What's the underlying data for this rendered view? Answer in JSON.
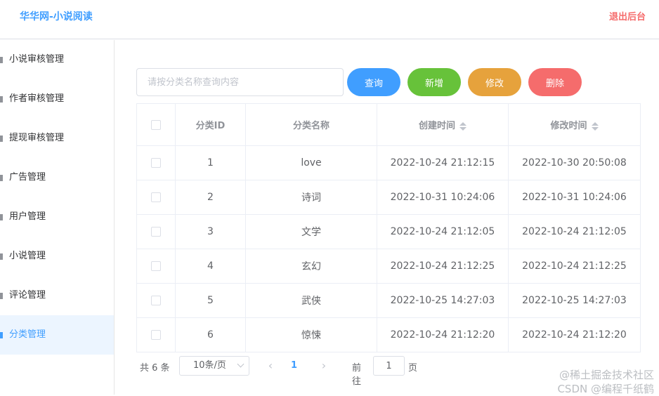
{
  "header": {
    "title": "华华网-小说阅读",
    "logout": "退出后台"
  },
  "sidebar": {
    "items": [
      {
        "label": "小说审核管理",
        "active": false
      },
      {
        "label": "作者审核管理",
        "active": false
      },
      {
        "label": "提现审核管理",
        "active": false
      },
      {
        "label": "广告管理",
        "active": false
      },
      {
        "label": "用户管理",
        "active": false
      },
      {
        "label": "小说管理",
        "active": false
      },
      {
        "label": "评论管理",
        "active": false
      },
      {
        "label": "分类管理",
        "active": true
      }
    ]
  },
  "search": {
    "placeholder": "请按分类名称查询内容",
    "value": ""
  },
  "buttons": {
    "query": "查询",
    "add": "新增",
    "edit": "修改",
    "delete": "删除"
  },
  "table": {
    "headers": {
      "id": "分类ID",
      "name": "分类名称",
      "created": "创建时间",
      "modified": "修改时间"
    },
    "rows": [
      {
        "id": "1",
        "name": "love",
        "created": "2022-10-24 21:12:15",
        "modified": "2022-10-30 20:50:08"
      },
      {
        "id": "2",
        "name": "诗词",
        "created": "2022-10-31 10:24:06",
        "modified": "2022-10-31 10:24:06"
      },
      {
        "id": "3",
        "name": "文学",
        "created": "2022-10-24 21:12:05",
        "modified": "2022-10-24 21:12:05"
      },
      {
        "id": "4",
        "name": "玄幻",
        "created": "2022-10-24 21:12:25",
        "modified": "2022-10-24 21:12:25"
      },
      {
        "id": "5",
        "name": "武侠",
        "created": "2022-10-25 14:27:03",
        "modified": "2022-10-25 14:27:03"
      },
      {
        "id": "6",
        "name": "惊悚",
        "created": "2022-10-24 21:12:20",
        "modified": "2022-10-24 21:12:20"
      }
    ]
  },
  "pagination": {
    "total": "共 6 条",
    "page_size": "10条/页",
    "prev": "‹",
    "next": "›",
    "current": "1",
    "goto_label": "前往",
    "goto_value": "1",
    "page_suffix": "页"
  },
  "watermark": {
    "line1": "@稀土掘金技术社区",
    "line2": "CSDN @编程千纸鹤"
  },
  "colors": {
    "primary": "#409eff",
    "success": "#67c23a",
    "warning": "#e6a23c",
    "danger": "#f56c6c"
  }
}
